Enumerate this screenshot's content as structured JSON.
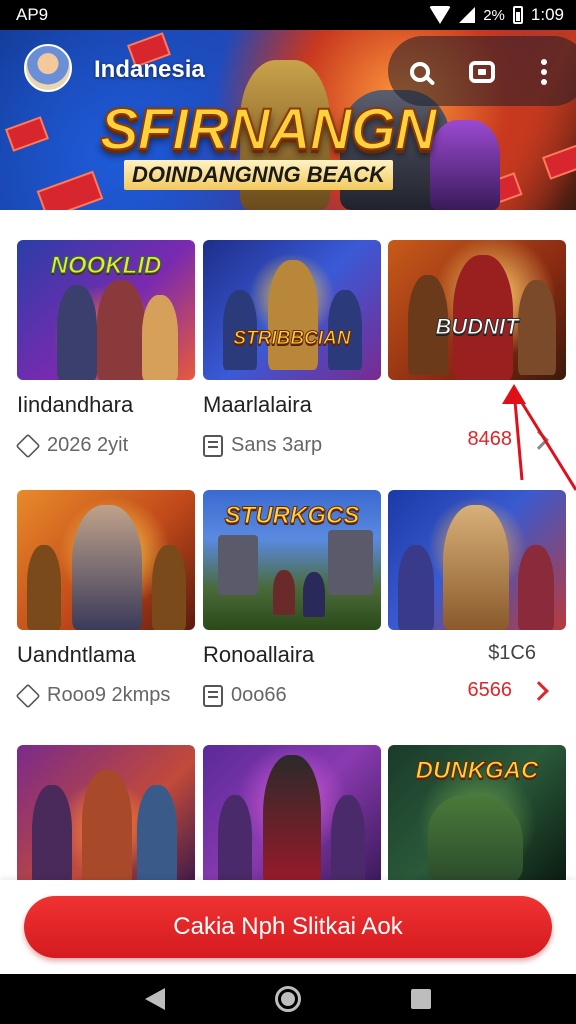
{
  "status_bar": {
    "carrier": "AP9",
    "battery": "2%",
    "time": "1:09"
  },
  "header": {
    "region": "Indanesia",
    "banner_title": "SFIRNANGN",
    "banner_subtitle": "DOINDANGNNG BEACK",
    "actions": [
      "search-icon",
      "cast-icon",
      "more-vert-icon"
    ]
  },
  "games": [
    {
      "thumb_label": "NOOKLID",
      "title": "Iindandhara",
      "meta_icon": "tag-icon",
      "meta": "2026 2yit",
      "price": "",
      "arrow": false
    },
    {
      "thumb_label": "STRIBBCIAN",
      "title": "Maarlalaira",
      "meta_icon": "document-icon",
      "meta": "Sans 3arp",
      "price": "",
      "arrow": false
    },
    {
      "thumb_label": "BUDNIT",
      "title": "",
      "meta_icon": "",
      "meta": "",
      "price": "8468",
      "arrow": true
    },
    {
      "thumb_label": "",
      "title": "Uandntlama",
      "meta_icon": "tag-icon",
      "meta": "Rooo9 2kmps",
      "price": "",
      "arrow": false
    },
    {
      "thumb_label": "STURKGCS",
      "title": "Ronoallaira",
      "meta_icon": "document-icon",
      "meta": "0oo66",
      "price": "",
      "arrow": false
    },
    {
      "thumb_label": "",
      "title": "",
      "meta_icon": "",
      "meta": "",
      "price_top": "$1C6",
      "price": "6566",
      "arrow": true
    },
    {
      "thumb_label": "",
      "title": "",
      "meta_icon": "",
      "meta": "",
      "price": "",
      "arrow": false
    },
    {
      "thumb_label": "",
      "title": "",
      "meta_icon": "",
      "meta": "",
      "price": "",
      "arrow": false
    },
    {
      "thumb_label": "DUNKGAC",
      "title": "",
      "meta_icon": "",
      "meta": "",
      "price": "",
      "arrow": false
    }
  ],
  "cta": {
    "label": "Cakia Nph Slitkai Aok"
  },
  "colors": {
    "accent": "#e0252a",
    "cta": "#d41b1f"
  },
  "nav_bar": [
    "back-icon",
    "home-icon",
    "recents-icon"
  ]
}
